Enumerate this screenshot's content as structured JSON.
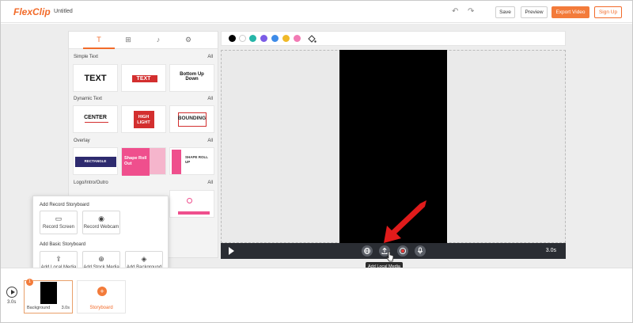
{
  "app": {
    "logo": "FlexClip",
    "doc_title": "Untitled"
  },
  "toolbar": {
    "save": "Save",
    "preview": "Preview",
    "export": "Export Video",
    "signup": "Sign Up",
    "undo_icon": "undo-icon",
    "redo_icon": "redo-icon"
  },
  "panel": {
    "tabs": [
      "text-icon",
      "elements-icon",
      "music-icon",
      "settings-icon"
    ],
    "sections": [
      {
        "title": "Simple Text",
        "all": "All",
        "cards": [
          "TEXT",
          "TEXT",
          "Bottom Up Down"
        ]
      },
      {
        "title": "Dynamic Text",
        "all": "All",
        "cards": [
          "CENTER",
          "HIGH LIGHT",
          "BOUNDING"
        ]
      },
      {
        "title": "Overlay",
        "all": "All",
        "cards": [
          "RECTANGLE",
          "Shape Roll Out",
          "SHAPE ROLL UP"
        ]
      },
      {
        "title": "Logo/Intro/Outro",
        "all": "All",
        "cards": []
      }
    ]
  },
  "colors": [
    "#000000",
    "#ffffff",
    "#26b5a8",
    "#7b5ce6",
    "#3d8be8",
    "#f0b928",
    "#f27ab4"
  ],
  "player": {
    "duration": "3.0s",
    "tooltip": "Add Local Media"
  },
  "popup": {
    "record_title": "Add Record Storyboard",
    "record_screen": "Record Screen",
    "record_webcam": "Record Webcam",
    "basic_title": "Add Basic Storyboard",
    "local_media": "Add Local Media",
    "stock_media": "Add Stock Media",
    "background": "Add Background"
  },
  "timeline": {
    "time": "3.0s",
    "clip_name": "Background",
    "clip_duration": "3.0s",
    "clip_number": "1",
    "storyboard_label": "Storyboard"
  }
}
